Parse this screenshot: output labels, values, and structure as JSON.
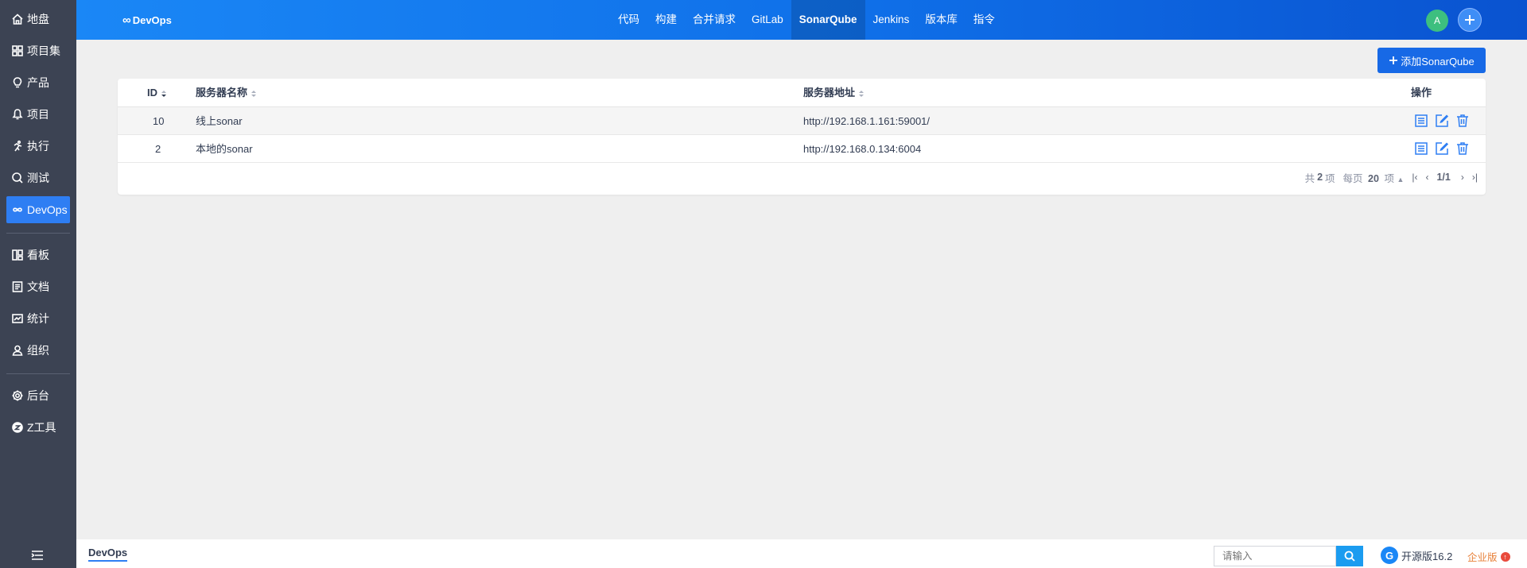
{
  "sidebar": {
    "items": [
      {
        "label": "地盘",
        "icon": "home-icon"
      },
      {
        "label": "项目集",
        "icon": "grid-icon"
      },
      {
        "label": "产品",
        "icon": "bulb-icon"
      },
      {
        "label": "项目",
        "icon": "bell-icon"
      },
      {
        "label": "执行",
        "icon": "run-icon"
      },
      {
        "label": "测试",
        "icon": "search-check-icon"
      },
      {
        "label": "DevOps",
        "icon": "infinity-icon",
        "active": true
      },
      {
        "label": "看板",
        "icon": "board-icon"
      },
      {
        "label": "文档",
        "icon": "doc-icon"
      },
      {
        "label": "统计",
        "icon": "chart-icon"
      },
      {
        "label": "组织",
        "icon": "user-icon"
      },
      {
        "label": "后台",
        "icon": "gear-icon"
      },
      {
        "label": "Z工具",
        "icon": "tool-icon"
      }
    ]
  },
  "header": {
    "brand": "DevOps",
    "tabs": [
      "代码",
      "构建",
      "合并请求",
      "GitLab",
      "SonarQube",
      "Jenkins",
      "版本库",
      "指令"
    ],
    "active_tab": "SonarQube",
    "avatar_letter": "A"
  },
  "toolbar": {
    "add_label": "添加SonarQube"
  },
  "table": {
    "headers": {
      "id": "ID",
      "name": "服务器名称",
      "url": "服务器地址",
      "actions": "操作"
    },
    "rows": [
      {
        "id": "10",
        "name": "线上sonar",
        "url": "http://192.168.1.161:59001/"
      },
      {
        "id": "2",
        "name": "本地的sonar",
        "url": "http://192.168.0.134:6004"
      }
    ]
  },
  "pager": {
    "total_prefix": "共",
    "total": "2",
    "total_suffix": "项",
    "per_page_prefix": "每页",
    "per_page": "20",
    "per_page_suffix": "项",
    "page": "1/1"
  },
  "footer": {
    "breadcrumb": "DevOps",
    "search_placeholder": "请输入",
    "version": "开源版16.2",
    "enterprise": "企业版"
  },
  "colors": {
    "accent": "#2e7ef3",
    "sidebar_bg": "#3c4353",
    "header_from": "#1a87f6",
    "header_to": "#0a53d0"
  }
}
